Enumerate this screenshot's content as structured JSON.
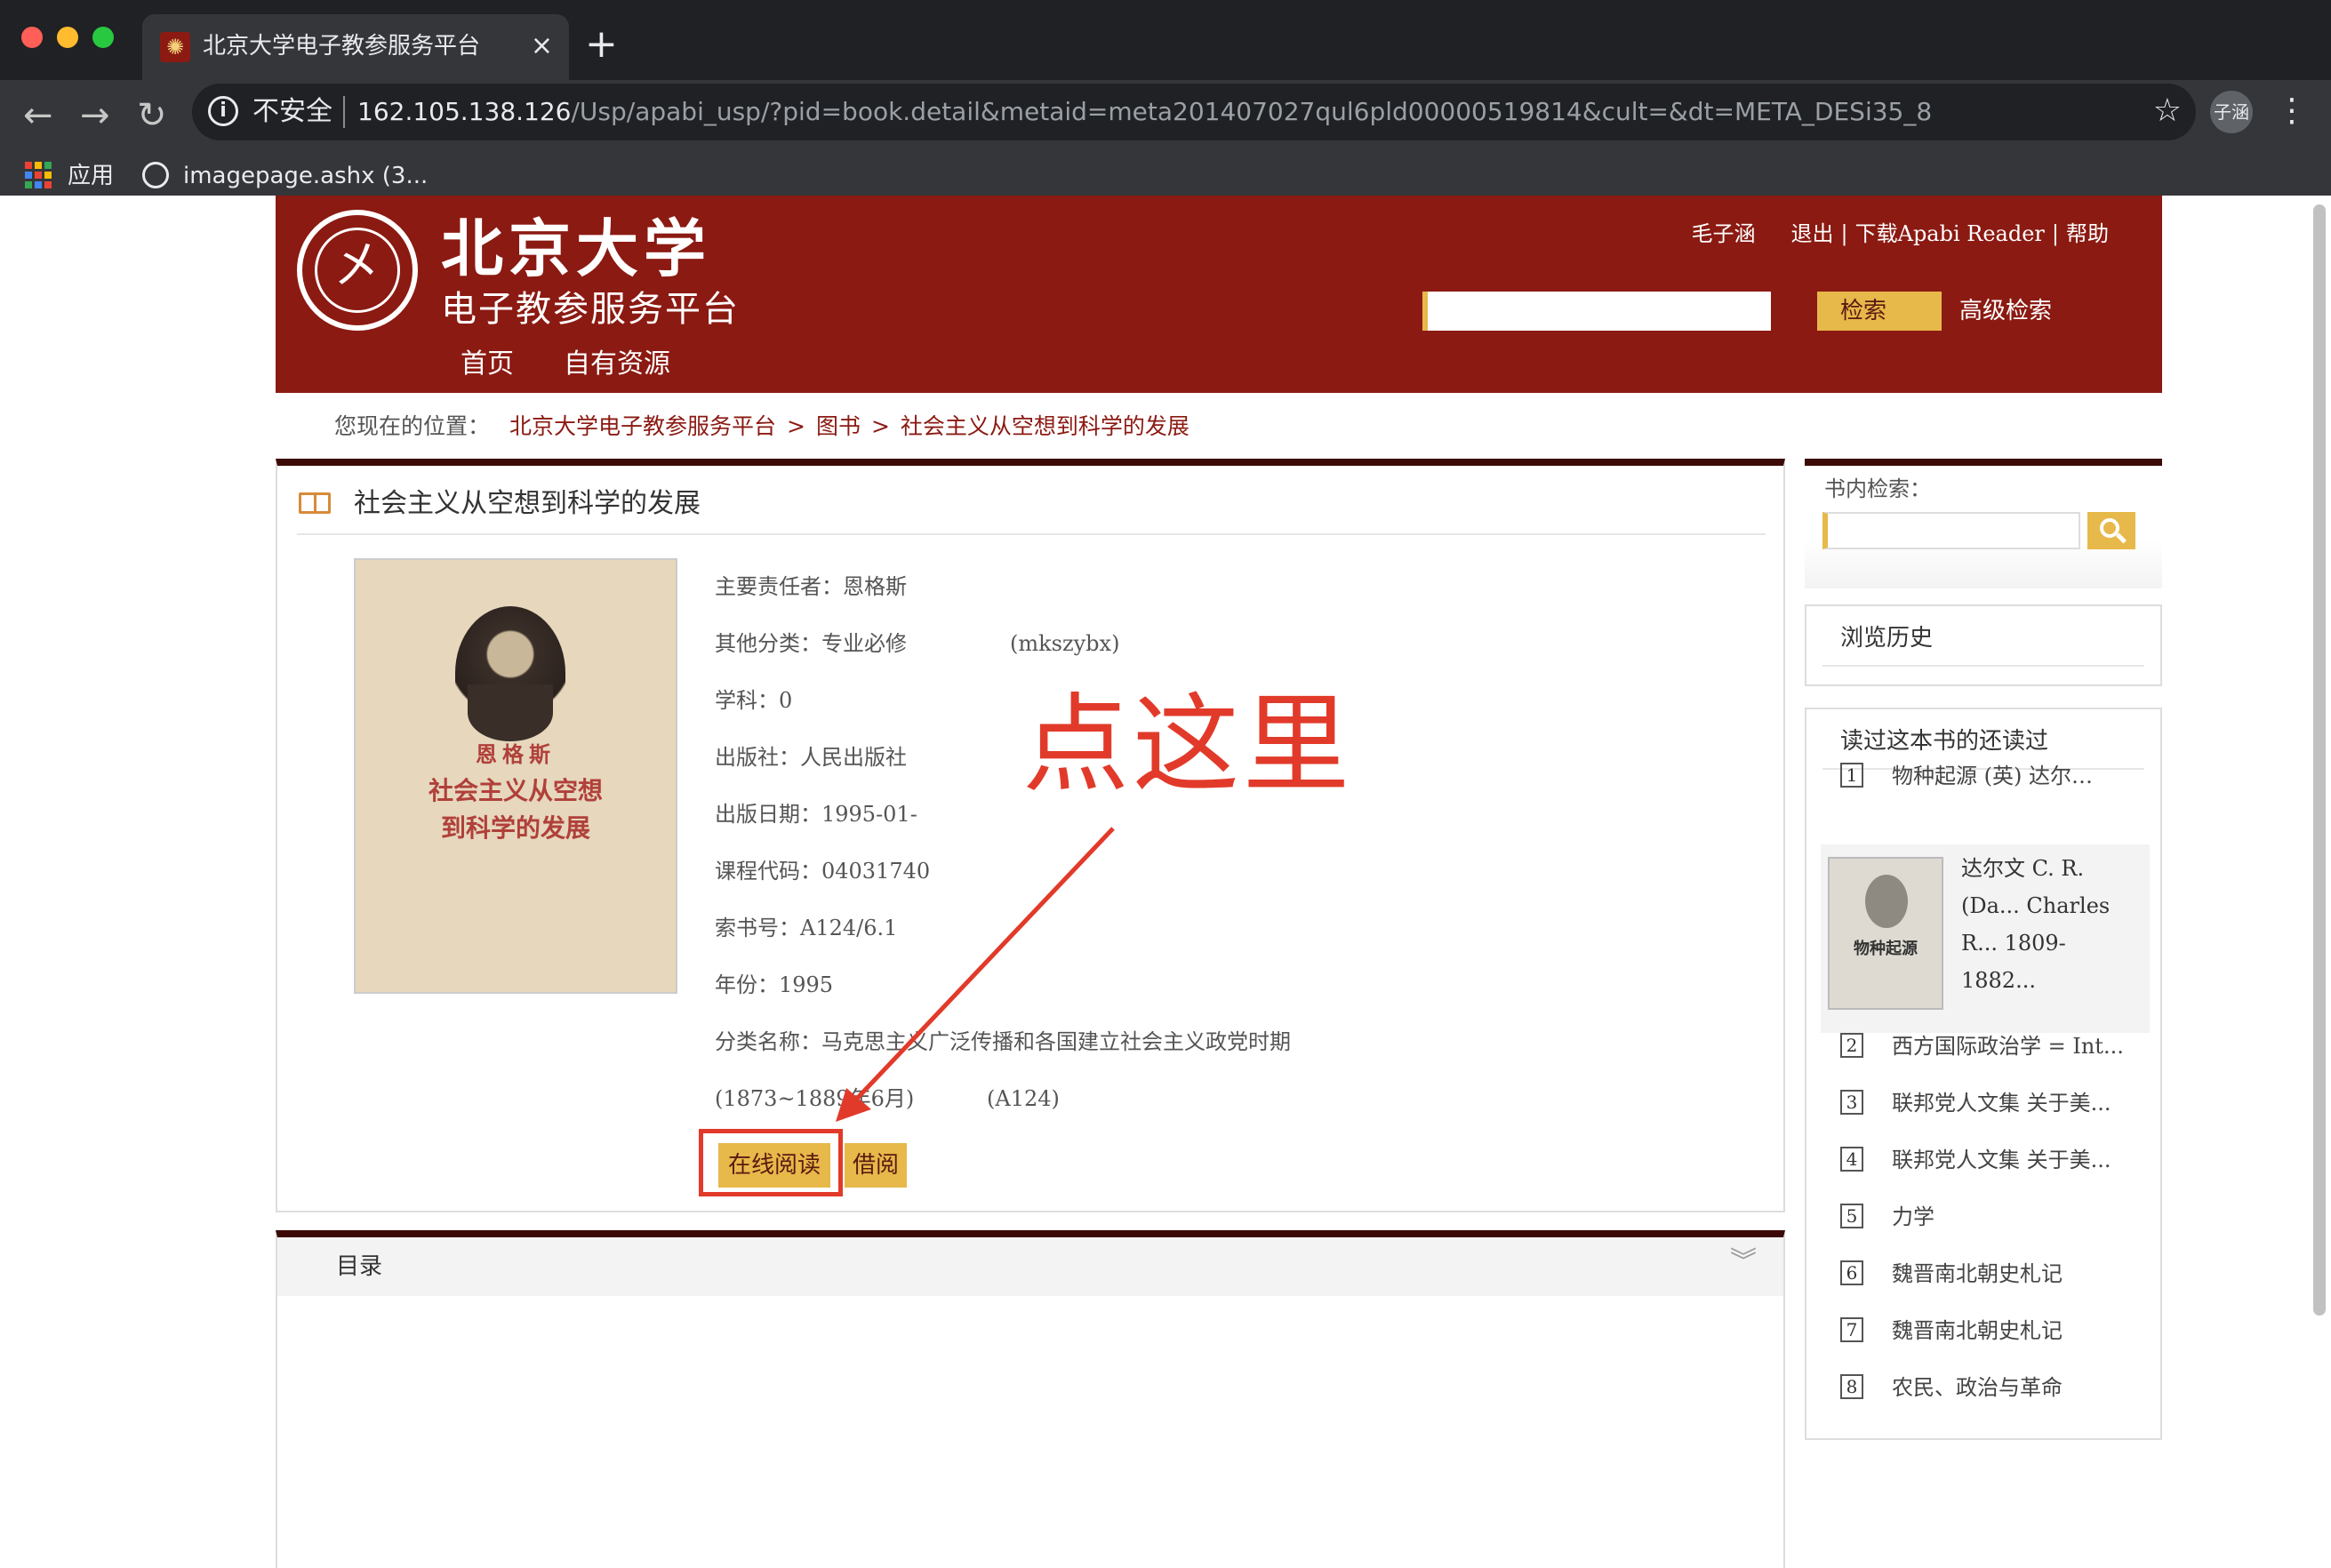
{
  "browser": {
    "tab_title": "北京大学电子教参服务平台",
    "close_glyph": "×",
    "new_tab_glyph": "+",
    "back_glyph": "←",
    "forward_glyph": "→",
    "reload_glyph": "↻",
    "security_label": "不安全",
    "info_glyph": "i",
    "url_host": "162.105.138.126",
    "url_path": "/Usp/apabi_usp/?pid=book.detail&metaid=meta201407027qul6pld00000519814&cult=&dt=META_DESi35_8",
    "star_glyph": "☆",
    "profile_label": "子涵",
    "menu_glyph": "⋮",
    "bookmarks": {
      "apps_label": "应用",
      "item_label": "imagepage.ashx (3..."
    }
  },
  "site": {
    "logo_glyph": "㐅",
    "logo_name": "北京大学",
    "logo_subtitle": "电子教参服务平台",
    "nav": {
      "home": "首页",
      "own": "自有资源"
    },
    "user_links": {
      "user": "毛子涵",
      "logout": "退出",
      "sep1": "|",
      "download": "下载Apabi Reader",
      "sep2": "|",
      "help": "帮助"
    },
    "search_button": "检索",
    "advanced_search": "高级检索"
  },
  "breadcrumb": {
    "prefix": "您现在的位置：",
    "items": [
      "北京大学电子教参服务平台",
      "图书",
      "社会主义从空想到科学的发展"
    ],
    "arrow": ">"
  },
  "book": {
    "title": "社会主义从空想到科学的发展",
    "cover": {
      "author": "恩格斯",
      "title_line1": "社会主义从空想",
      "title_line2": "到科学的发展"
    },
    "meta": {
      "author": "主要责任者：恩格斯",
      "category": "其他分类：专业必修",
      "category_code": "(mkszybx)",
      "subject": "学科：0",
      "publisher": "出版社：人民出版社",
      "pub_date": "出版日期：1995-01-",
      "course_code": "课程代码：04031740",
      "call_number": "索书号：A124/6.1",
      "year": "年份：1995",
      "class_name": "分类名称：马克思主义广泛传播和各国建立社会主义政党时期",
      "class_period": "(1873~1889年6月)",
      "class_code": "(A124)"
    },
    "buttons": {
      "read_online": "在线阅读",
      "borrow": "借阅"
    }
  },
  "annotation": {
    "text": "点这里",
    "color": "#e23a2a"
  },
  "toc": {
    "title": "目录",
    "toggle_glyph": "︾"
  },
  "sidebar": {
    "inbook_label": "书内检索：",
    "history_title": "浏览历史",
    "also_title": "读过这本书的还读过",
    "featured": {
      "cover_title": "物种起源",
      "text": "达尔文 C. R.\n(Da... Charles\nR... 1809-\n1882..."
    },
    "also_items": [
      {
        "num": "1",
        "label": "物种起源 (英) 达尔…"
      },
      {
        "num": "2",
        "label": "西方国际政治学 = Int..."
      },
      {
        "num": "3",
        "label": "联邦党人文集 关于美..."
      },
      {
        "num": "4",
        "label": "联邦党人文集 关于美..."
      },
      {
        "num": "5",
        "label": "力学"
      },
      {
        "num": "6",
        "label": "魏晋南北朝史札记"
      },
      {
        "num": "7",
        "label": "魏晋南北朝史札记"
      },
      {
        "num": "8",
        "label": "农民、政治与革命"
      }
    ]
  },
  "colors": {
    "brand_red": "#8b1a12",
    "panel_top": "#3c0a06",
    "button_gold": "#e7b84a",
    "chrome_dark": "#202124"
  }
}
